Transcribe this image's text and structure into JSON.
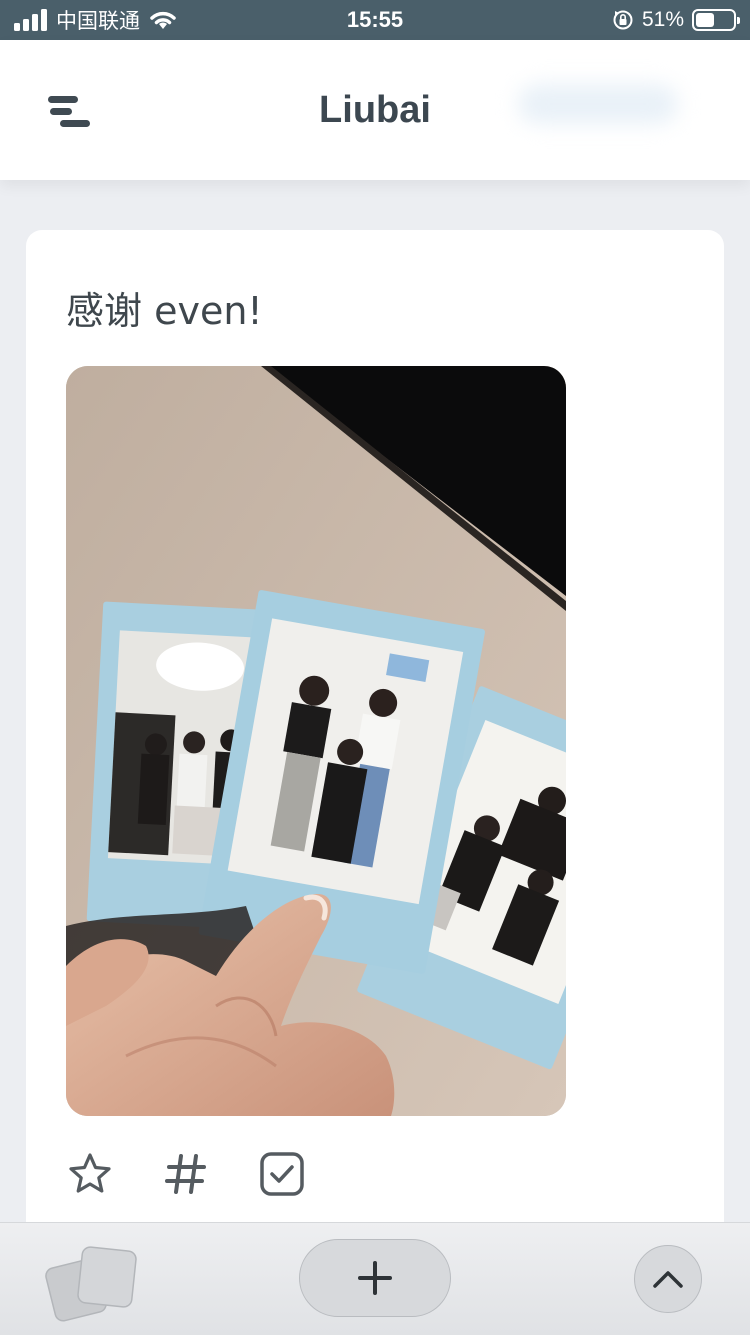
{
  "status_bar": {
    "carrier": "中国联通",
    "time": "15:55",
    "battery_percent": "51%",
    "battery_level": 0.51,
    "icons": [
      "signal-icon",
      "wifi-icon",
      "orientation-lock-icon",
      "battery-icon"
    ]
  },
  "header": {
    "title": "Liubai",
    "menu_icon": "menu-icon"
  },
  "post": {
    "text": "感谢 even!",
    "image_alt": "hand holding three instant photos of friends",
    "actions": [
      "star-icon",
      "hash-icon",
      "checkbox-icon"
    ]
  },
  "bottom_bar": {
    "left_icon": "cards-icon",
    "center_icon": "plus-icon",
    "right_icon": "chevron-up-icon"
  },
  "colors": {
    "status_bar_bg": "#4a5f6a",
    "title": "#3c4750",
    "page_bg": "#eceef2",
    "photo_frame_blue": "#a9cfe0"
  }
}
